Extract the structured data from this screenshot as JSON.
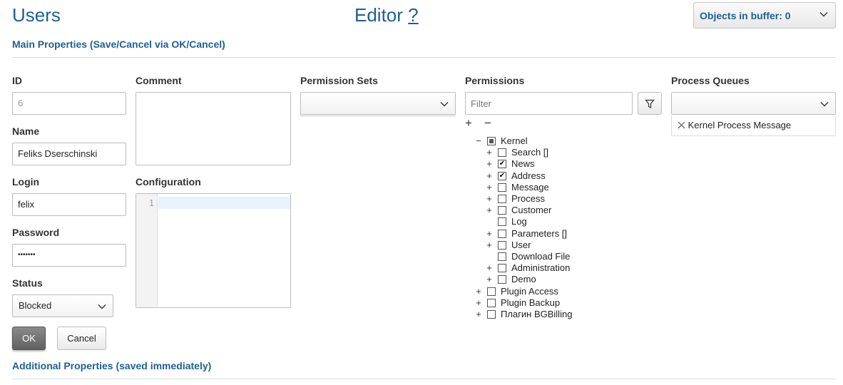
{
  "header": {
    "title": "Users",
    "editor_title": "Editor",
    "help_symbol": "?",
    "buffer_label": "Objects in buffer: 0"
  },
  "sections": {
    "main": "Main Properties (Save/Cancel via OK/Cancel)",
    "additional": "Additional Properties (saved immediately)"
  },
  "form": {
    "id_label": "ID",
    "id_value": "6",
    "name_label": "Name",
    "name_value": "Feliks Dserschinski",
    "login_label": "Login",
    "login_value": "felix",
    "password_label": "Password",
    "password_value": "•••••••",
    "status_label": "Status",
    "status_value": "Blocked",
    "comment_label": "Comment",
    "configuration_label": "Configuration",
    "code_line_number": "1",
    "permission_sets_label": "Permission Sets",
    "permissions_label": "Permissions",
    "filter_placeholder": "Filter",
    "process_queues_label": "Process Queues",
    "queue_chip": "Kernel Process Message",
    "ok_label": "OK",
    "cancel_label": "Cancel"
  },
  "tree_controls": {
    "expand_all": "+",
    "collapse_all": "−"
  },
  "tree": [
    {
      "label": "Kernel",
      "level": 0,
      "toggle": "−",
      "state": "partial"
    },
    {
      "label": "Search []",
      "level": 1,
      "toggle": "+",
      "state": "unchecked"
    },
    {
      "label": "News",
      "level": 1,
      "toggle": "+",
      "state": "checked"
    },
    {
      "label": "Address",
      "level": 1,
      "toggle": "+",
      "state": "checked"
    },
    {
      "label": "Message",
      "level": 1,
      "toggle": "+",
      "state": "unchecked"
    },
    {
      "label": "Process",
      "level": 1,
      "toggle": "+",
      "state": "unchecked"
    },
    {
      "label": "Customer",
      "level": 1,
      "toggle": "+",
      "state": "unchecked"
    },
    {
      "label": "Log",
      "level": 1,
      "toggle": "",
      "state": "unchecked"
    },
    {
      "label": "Parameters []",
      "level": 1,
      "toggle": "+",
      "state": "unchecked"
    },
    {
      "label": "User",
      "level": 1,
      "toggle": "+",
      "state": "unchecked"
    },
    {
      "label": "Download File",
      "level": 1,
      "toggle": "",
      "state": "unchecked"
    },
    {
      "label": "Administration",
      "level": 1,
      "toggle": "+",
      "state": "unchecked"
    },
    {
      "label": "Demo",
      "level": 1,
      "toggle": "+",
      "state": "unchecked"
    },
    {
      "label": "Plugin Access",
      "level": 0,
      "toggle": "+",
      "state": "unchecked"
    },
    {
      "label": "Plugin Backup",
      "level": 0,
      "toggle": "+",
      "state": "unchecked"
    },
    {
      "label": "Плагин BGBilling",
      "level": 0,
      "toggle": "+",
      "state": "unchecked"
    }
  ],
  "colors": {
    "accent": "#1f5f93",
    "ok_button": "#6f6f6f"
  },
  "icons": {
    "dropdown": "chevron-down-icon",
    "filter": "funnel-icon",
    "remove": "close-icon"
  }
}
